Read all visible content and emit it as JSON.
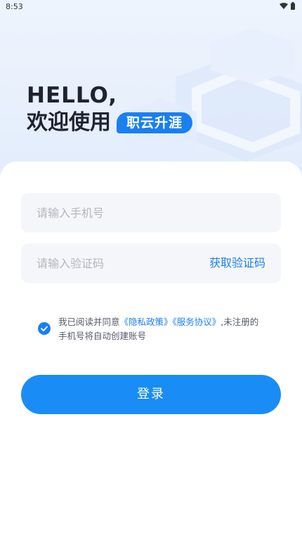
{
  "status_bar": {
    "time": "8:53"
  },
  "greeting": {
    "hello": "HELLO,",
    "welcome": "欢迎使用",
    "brand": "职云升涯"
  },
  "form": {
    "phone_placeholder": "请输入手机号",
    "code_placeholder": "请输入验证码",
    "get_code_label": "获取验证码"
  },
  "agreement": {
    "checked": true,
    "prefix": "我已阅读并同意",
    "privacy_link": "《隐私政策》",
    "service_link": "《服务协议》",
    "suffix": ",未注册的手机号将自动创建账号"
  },
  "login_label": "登录",
  "colors": {
    "accent": "#1a7ff0",
    "button": "#1a8cf6",
    "field_bg": "#f5f6fa",
    "hero_bg": "#e6effc"
  }
}
